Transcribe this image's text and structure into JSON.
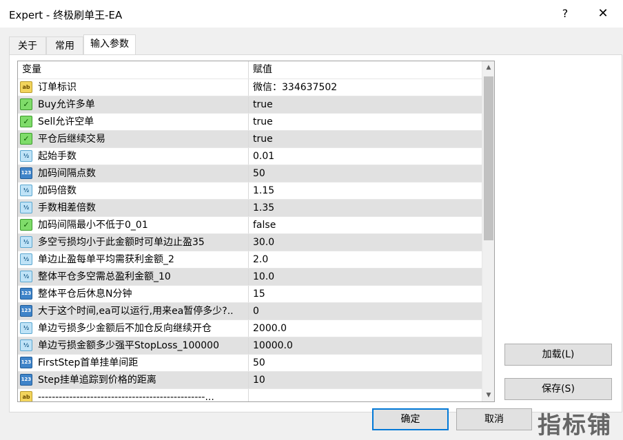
{
  "window": {
    "title": "Expert - 终极刷单王-EA",
    "help_glyph": "?",
    "close_glyph": "✕"
  },
  "tabs": [
    {
      "label": "关于"
    },
    {
      "label": "常用"
    },
    {
      "label": "输入参数"
    }
  ],
  "grid": {
    "headers": {
      "variable": "变量",
      "value": "赋值"
    },
    "rows": [
      {
        "type": "string",
        "icon": "ab",
        "name": "订单标识",
        "value": "微信：334637502"
      },
      {
        "type": "bool",
        "icon": "✓",
        "name": "Buy允许多单",
        "value": "true"
      },
      {
        "type": "bool",
        "icon": "✓",
        "name": "Sell允许空单",
        "value": "true"
      },
      {
        "type": "bool",
        "icon": "✓",
        "name": "平仓后继续交易",
        "value": "true"
      },
      {
        "type": "double",
        "icon": "½",
        "name": "起始手数",
        "value": "0.01"
      },
      {
        "type": "int",
        "icon": "123",
        "name": "加码间隔点数",
        "value": "50"
      },
      {
        "type": "double",
        "icon": "½",
        "name": "加码倍数",
        "value": "1.15"
      },
      {
        "type": "double",
        "icon": "½",
        "name": "手数相差倍数",
        "value": "1.35"
      },
      {
        "type": "bool",
        "icon": "✓",
        "name": "加码间隔最小不低于0_01",
        "value": "false"
      },
      {
        "type": "double",
        "icon": "½",
        "name": "多空亏损均小于此金额时可单边止盈35",
        "value": "30.0"
      },
      {
        "type": "double",
        "icon": "½",
        "name": "单边止盈每单平均需获利金额_2",
        "value": "2.0"
      },
      {
        "type": "double",
        "icon": "½",
        "name": "整体平仓多空需总盈利金额_10",
        "value": "10.0"
      },
      {
        "type": "int",
        "icon": "123",
        "name": "整体平仓后休息N分钟",
        "value": "15"
      },
      {
        "type": "int",
        "icon": "123",
        "name": "大于这个时间,ea可以运行,用来ea暂停多少?..",
        "value": "0"
      },
      {
        "type": "double",
        "icon": "½",
        "name": "单边亏损多少金额后不加仓反向继续开仓",
        "value": "2000.0"
      },
      {
        "type": "double",
        "icon": "½",
        "name": "单边亏损金额多少强平StopLoss_100000",
        "value": "10000.0"
      },
      {
        "type": "int",
        "icon": "123",
        "name": "FirstStep首单挂单间距",
        "value": "50"
      },
      {
        "type": "int",
        "icon": "123",
        "name": "Step挂单追踪到价格的距离",
        "value": "10"
      },
      {
        "type": "string",
        "icon": "ab",
        "name": "------------------------------------------------...",
        "value": ""
      }
    ]
  },
  "buttons": {
    "load": "加载(L)",
    "save": "保存(S)",
    "ok": "确定",
    "cancel": "取消"
  },
  "watermark": "指标铺",
  "colors": {
    "accent": "#0078d7",
    "alt_row": "#e1e1e1"
  }
}
